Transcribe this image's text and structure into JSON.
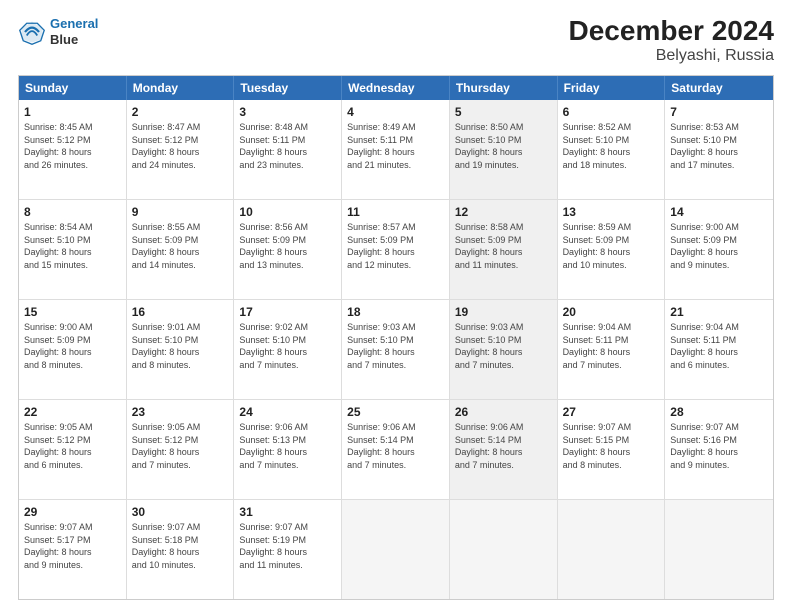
{
  "logo": {
    "line1": "General",
    "line2": "Blue"
  },
  "title": "December 2024",
  "subtitle": "Belyashi, Russia",
  "days_of_week": [
    "Sunday",
    "Monday",
    "Tuesday",
    "Wednesday",
    "Thursday",
    "Friday",
    "Saturday"
  ],
  "weeks": [
    [
      {
        "day": "1",
        "text": "Sunrise: 8:45 AM\nSunset: 5:12 PM\nDaylight: 8 hours\nand 26 minutes.",
        "shaded": false
      },
      {
        "day": "2",
        "text": "Sunrise: 8:47 AM\nSunset: 5:12 PM\nDaylight: 8 hours\nand 24 minutes.",
        "shaded": false
      },
      {
        "day": "3",
        "text": "Sunrise: 8:48 AM\nSunset: 5:11 PM\nDaylight: 8 hours\nand 23 minutes.",
        "shaded": false
      },
      {
        "day": "4",
        "text": "Sunrise: 8:49 AM\nSunset: 5:11 PM\nDaylight: 8 hours\nand 21 minutes.",
        "shaded": false
      },
      {
        "day": "5",
        "text": "Sunrise: 8:50 AM\nSunset: 5:10 PM\nDaylight: 8 hours\nand 19 minutes.",
        "shaded": true
      },
      {
        "day": "6",
        "text": "Sunrise: 8:52 AM\nSunset: 5:10 PM\nDaylight: 8 hours\nand 18 minutes.",
        "shaded": false
      },
      {
        "day": "7",
        "text": "Sunrise: 8:53 AM\nSunset: 5:10 PM\nDaylight: 8 hours\nand 17 minutes.",
        "shaded": false
      }
    ],
    [
      {
        "day": "8",
        "text": "Sunrise: 8:54 AM\nSunset: 5:10 PM\nDaylight: 8 hours\nand 15 minutes.",
        "shaded": false
      },
      {
        "day": "9",
        "text": "Sunrise: 8:55 AM\nSunset: 5:09 PM\nDaylight: 8 hours\nand 14 minutes.",
        "shaded": false
      },
      {
        "day": "10",
        "text": "Sunrise: 8:56 AM\nSunset: 5:09 PM\nDaylight: 8 hours\nand 13 minutes.",
        "shaded": false
      },
      {
        "day": "11",
        "text": "Sunrise: 8:57 AM\nSunset: 5:09 PM\nDaylight: 8 hours\nand 12 minutes.",
        "shaded": false
      },
      {
        "day": "12",
        "text": "Sunrise: 8:58 AM\nSunset: 5:09 PM\nDaylight: 8 hours\nand 11 minutes.",
        "shaded": true
      },
      {
        "day": "13",
        "text": "Sunrise: 8:59 AM\nSunset: 5:09 PM\nDaylight: 8 hours\nand 10 minutes.",
        "shaded": false
      },
      {
        "day": "14",
        "text": "Sunrise: 9:00 AM\nSunset: 5:09 PM\nDaylight: 8 hours\nand 9 minutes.",
        "shaded": false
      }
    ],
    [
      {
        "day": "15",
        "text": "Sunrise: 9:00 AM\nSunset: 5:09 PM\nDaylight: 8 hours\nand 8 minutes.",
        "shaded": false
      },
      {
        "day": "16",
        "text": "Sunrise: 9:01 AM\nSunset: 5:10 PM\nDaylight: 8 hours\nand 8 minutes.",
        "shaded": false
      },
      {
        "day": "17",
        "text": "Sunrise: 9:02 AM\nSunset: 5:10 PM\nDaylight: 8 hours\nand 7 minutes.",
        "shaded": false
      },
      {
        "day": "18",
        "text": "Sunrise: 9:03 AM\nSunset: 5:10 PM\nDaylight: 8 hours\nand 7 minutes.",
        "shaded": false
      },
      {
        "day": "19",
        "text": "Sunrise: 9:03 AM\nSunset: 5:10 PM\nDaylight: 8 hours\nand 7 minutes.",
        "shaded": true
      },
      {
        "day": "20",
        "text": "Sunrise: 9:04 AM\nSunset: 5:11 PM\nDaylight: 8 hours\nand 7 minutes.",
        "shaded": false
      },
      {
        "day": "21",
        "text": "Sunrise: 9:04 AM\nSunset: 5:11 PM\nDaylight: 8 hours\nand 6 minutes.",
        "shaded": false
      }
    ],
    [
      {
        "day": "22",
        "text": "Sunrise: 9:05 AM\nSunset: 5:12 PM\nDaylight: 8 hours\nand 6 minutes.",
        "shaded": false
      },
      {
        "day": "23",
        "text": "Sunrise: 9:05 AM\nSunset: 5:12 PM\nDaylight: 8 hours\nand 7 minutes.",
        "shaded": false
      },
      {
        "day": "24",
        "text": "Sunrise: 9:06 AM\nSunset: 5:13 PM\nDaylight: 8 hours\nand 7 minutes.",
        "shaded": false
      },
      {
        "day": "25",
        "text": "Sunrise: 9:06 AM\nSunset: 5:14 PM\nDaylight: 8 hours\nand 7 minutes.",
        "shaded": false
      },
      {
        "day": "26",
        "text": "Sunrise: 9:06 AM\nSunset: 5:14 PM\nDaylight: 8 hours\nand 7 minutes.",
        "shaded": true
      },
      {
        "day": "27",
        "text": "Sunrise: 9:07 AM\nSunset: 5:15 PM\nDaylight: 8 hours\nand 8 minutes.",
        "shaded": false
      },
      {
        "day": "28",
        "text": "Sunrise: 9:07 AM\nSunset: 5:16 PM\nDaylight: 8 hours\nand 9 minutes.",
        "shaded": false
      }
    ],
    [
      {
        "day": "29",
        "text": "Sunrise: 9:07 AM\nSunset: 5:17 PM\nDaylight: 8 hours\nand 9 minutes.",
        "shaded": false
      },
      {
        "day": "30",
        "text": "Sunrise: 9:07 AM\nSunset: 5:18 PM\nDaylight: 8 hours\nand 10 minutes.",
        "shaded": false
      },
      {
        "day": "31",
        "text": "Sunrise: 9:07 AM\nSunset: 5:19 PM\nDaylight: 8 hours\nand 11 minutes.",
        "shaded": false
      },
      {
        "day": "",
        "text": "",
        "shaded": false,
        "empty": true
      },
      {
        "day": "",
        "text": "",
        "shaded": false,
        "empty": true
      },
      {
        "day": "",
        "text": "",
        "shaded": false,
        "empty": true
      },
      {
        "day": "",
        "text": "",
        "shaded": false,
        "empty": true
      }
    ]
  ]
}
